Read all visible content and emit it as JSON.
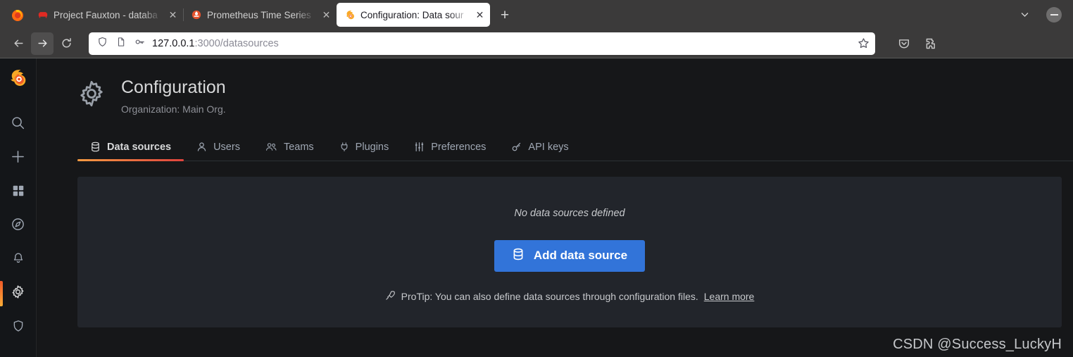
{
  "browser": {
    "tabs": [
      {
        "title": "Project Fauxton - databa",
        "favicon": "couchdb-icon",
        "active": false
      },
      {
        "title": "Prometheus Time Series",
        "favicon": "prometheus-icon",
        "active": false
      },
      {
        "title": "Configuration: Data sour",
        "favicon": "grafana-icon",
        "active": true
      }
    ],
    "new_tab_label": "+",
    "close_label": "✕",
    "nav": {
      "back": "back-button",
      "forward": "forward-button",
      "reload": "reload-button"
    },
    "url": {
      "prefix": "127.0.0.1",
      "suffix": ":3000/datasources",
      "full": "127.0.0.1:3000/datasources"
    },
    "window": {
      "tab_list": "chevron-down",
      "minimize": "minimize"
    }
  },
  "sidebar": {
    "logo": "grafana-logo",
    "items": [
      {
        "name": "search",
        "active": false
      },
      {
        "name": "create",
        "active": false
      },
      {
        "name": "dashboards",
        "active": false
      },
      {
        "name": "explore",
        "active": false
      },
      {
        "name": "alerting",
        "active": false
      },
      {
        "name": "configuration",
        "active": true
      },
      {
        "name": "server-admin",
        "active": false
      }
    ]
  },
  "header": {
    "title": "Configuration",
    "subtitle": "Organization: Main Org.",
    "icon": "gear-icon"
  },
  "tabs": [
    {
      "label": "Data sources",
      "icon": "database-icon",
      "active": true
    },
    {
      "label": "Users",
      "icon": "user-icon",
      "active": false
    },
    {
      "label": "Teams",
      "icon": "users-icon",
      "active": false
    },
    {
      "label": "Plugins",
      "icon": "plug-icon",
      "active": false
    },
    {
      "label": "Preferences",
      "icon": "sliders-icon",
      "active": false
    },
    {
      "label": "API keys",
      "icon": "key-icon",
      "active": false
    }
  ],
  "main": {
    "empty_message": "No data sources defined",
    "add_button_label": "Add data source",
    "protip_prefix": "ProTip: You can also define data sources through configuration files.",
    "protip_link": "Learn more",
    "protip_icon": "rocket-icon"
  },
  "watermark": "CSDN @Success_LuckyH",
  "colors": {
    "accent_orange": "#f05a28",
    "button_blue": "#3274d9",
    "panel_bg": "#22252b",
    "page_bg": "#161719"
  }
}
